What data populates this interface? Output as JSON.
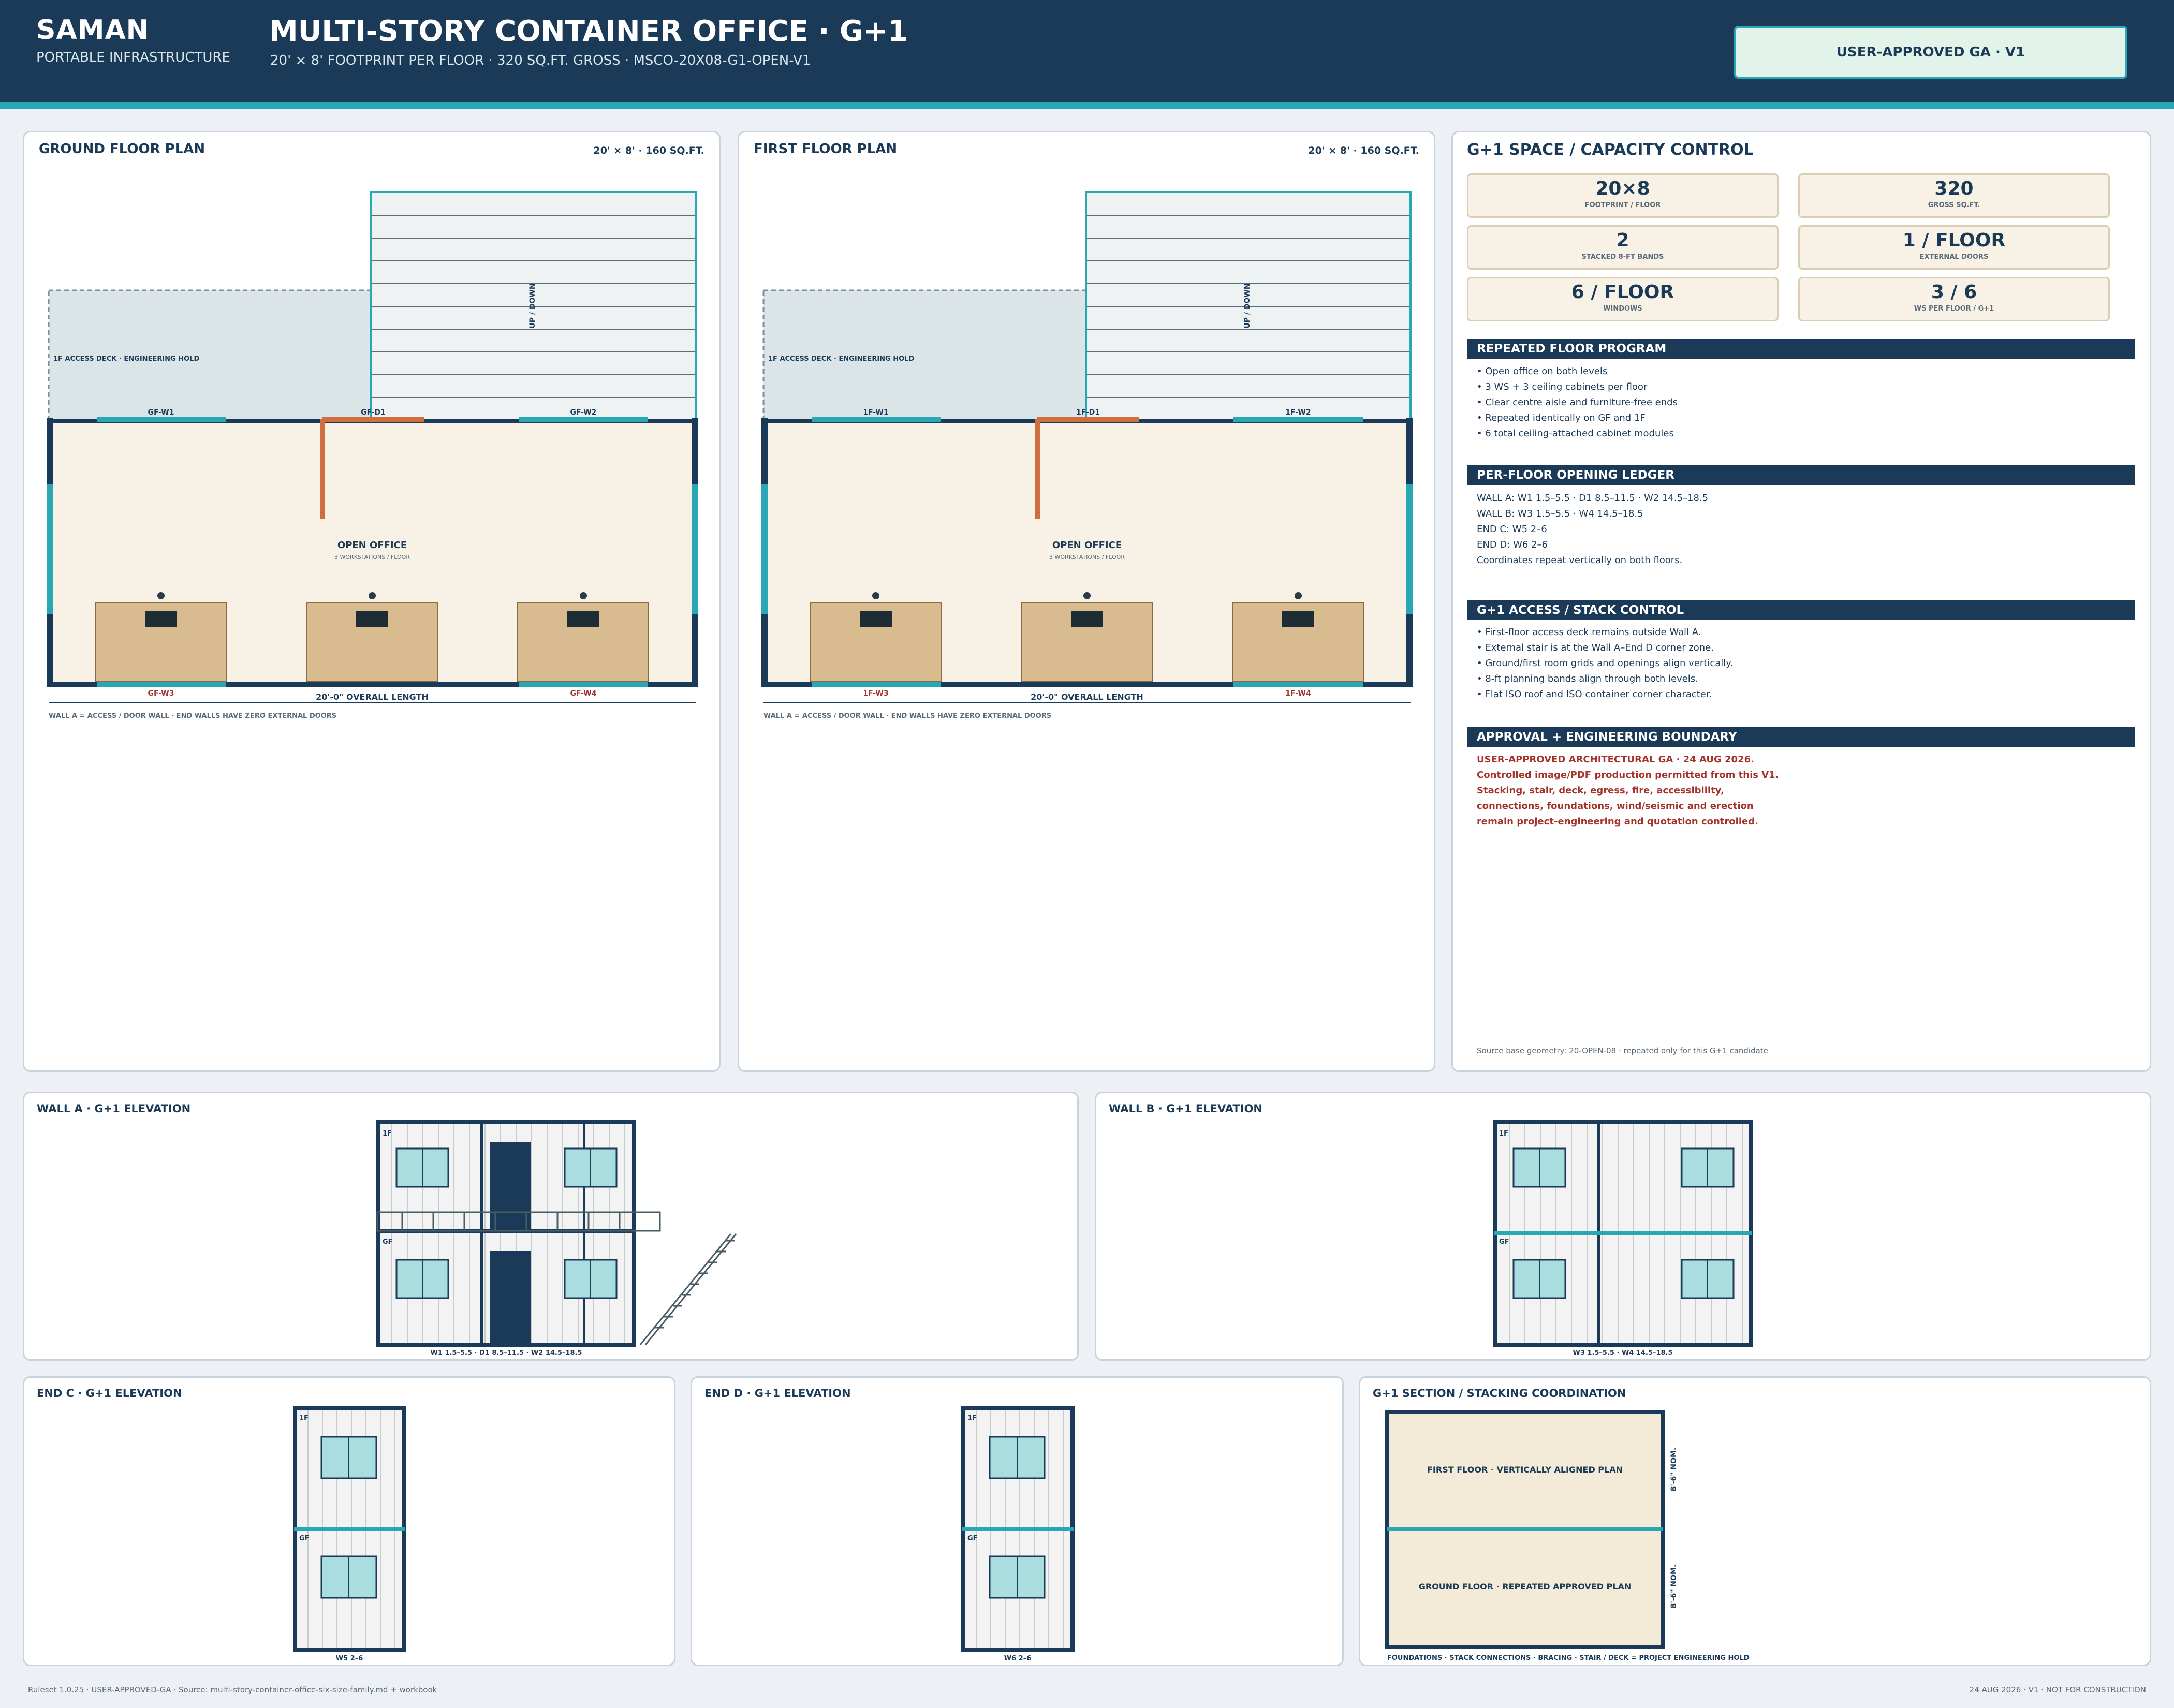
{
  "header": {
    "brand": "SAMAN",
    "brand_sub": "PORTABLE INFRASTRUCTURE",
    "title": "MULTI-STORY CONTAINER OFFICE · G+1",
    "subtitle": "20' × 8' FOOTPRINT PER FLOOR · 320 SQ.FT. GROSS · MSCO-20X08-G1-OPEN-V1",
    "badge": "USER-APPROVED GA · V1"
  },
  "ground_plan": {
    "title": "GROUND FLOOR PLAN",
    "meta": "20' × 8' · 160 SQ.FT.",
    "deck_label": "1F ACCESS DECK · ENGINEERING HOLD",
    "stair_label": "UP / DOWN",
    "room_label": "OPEN OFFICE",
    "room_sub": "3 WORKSTATIONS / FLOOR",
    "w1": "GF-W1",
    "d1": "GF-D1",
    "w2": "GF-W2",
    "w3": "GF-W3",
    "w4": "GF-W4",
    "dimension": "20'-0\" OVERALL LENGTH",
    "note": "WALL A = ACCESS / DOOR WALL · END WALLS HAVE ZERO EXTERNAL DOORS"
  },
  "first_plan": {
    "title": "FIRST FLOOR PLAN",
    "meta": "20' × 8' · 160 SQ.FT.",
    "deck_label": "1F ACCESS DECK · ENGINEERING HOLD",
    "stair_label": "UP / DOWN",
    "room_label": "OPEN OFFICE",
    "room_sub": "3 WORKSTATIONS / FLOOR",
    "w1": "1F-W1",
    "d1": "1F-D1",
    "w2": "1F-W2",
    "w3": "1F-W3",
    "w4": "1F-W4",
    "dimension": "20'-0\" OVERALL LENGTH",
    "note": "WALL A = ACCESS / DOOR WALL · END WALLS HAVE ZERO EXTERNAL DOORS"
  },
  "control": {
    "title": "G+1 SPACE / CAPACITY CONTROL",
    "stats": [
      {
        "value": "20×8",
        "label": "FOOTPRINT / FLOOR"
      },
      {
        "value": "320",
        "label": "GROSS SQ.FT."
      },
      {
        "value": "2",
        "label": "STACKED 8-FT BANDS"
      },
      {
        "value": "1 / FLOOR",
        "label": "EXTERNAL DOORS"
      },
      {
        "value": "6 / FLOOR",
        "label": "WINDOWS"
      },
      {
        "value": "3 / 6",
        "label": "WS PER FLOOR / G+1"
      }
    ],
    "sections": [
      {
        "title": "REPEATED FLOOR PROGRAM",
        "lines": [
          "• Open office on both levels",
          "• 3 WS + 3 ceiling cabinets per floor",
          "• Clear centre aisle and furniture-free ends",
          "• Repeated identically on GF and 1F",
          "• 6 total ceiling-attached cabinet modules"
        ]
      },
      {
        "title": "PER-FLOOR OPENING LEDGER",
        "lines": [
          "WALL A: W1 1.5–5.5 · D1 8.5–11.5 · W2 14.5–18.5",
          "WALL B: W3 1.5–5.5 · W4 14.5–18.5",
          "END C: W5 2–6",
          "END D: W6 2–6",
          "Coordinates repeat vertically on both floors."
        ]
      },
      {
        "title": "G+1 ACCESS / STACK CONTROL",
        "lines": [
          "• First-floor access deck remains outside Wall A.",
          "• External stair is at the Wall A–End D corner zone.",
          "• Ground/first room grids and openings align vertically.",
          "• 8-ft planning bands align through both levels.",
          "• Flat ISO roof and ISO container corner character."
        ]
      },
      {
        "title": "APPROVAL + ENGINEERING BOUNDARY",
        "lines": [
          "USER-APPROVED ARCHITECTURAL GA · 24 AUG 2026.",
          "Controlled image/PDF production permitted from this V1.",
          "Stacking, stair, deck, egress, fire, accessibility,",
          "connections, foundations, wind/seismic and erection",
          "remain project-engineering and quotation controlled."
        ]
      }
    ],
    "source_note": "Source base geometry: 20-OPEN-08 · repeated only for this G+1 candidate"
  },
  "elev_a": {
    "title": "WALL A · G+1 ELEVATION",
    "upper": "1F",
    "lower": "GF",
    "caption": "W1 1.5–5.5 · D1 8.5–11.5 · W2 14.5–18.5"
  },
  "elev_b": {
    "title": "WALL B · G+1 ELEVATION",
    "upper": "1F",
    "lower": "GF",
    "caption": "W3 1.5–5.5 · W4 14.5–18.5"
  },
  "elev_c": {
    "title": "END C · G+1 ELEVATION",
    "upper": "1F",
    "lower": "GF",
    "caption": "W5 2–6"
  },
  "elev_d": {
    "title": "END D · G+1 ELEVATION",
    "upper": "1F",
    "lower": "GF",
    "caption": "W6 2–6"
  },
  "section": {
    "title": "G+1 SECTION / STACKING COORDINATION",
    "upper": "FIRST FLOOR · VERTICALLY ALIGNED PLAN",
    "lower": "GROUND FLOOR · REPEATED APPROVED PLAN",
    "dim_upper": "8'-6\" NOM.",
    "dim_lower": "8'-6\" NOM.",
    "note": "FOUNDATIONS · STACK CONNECTIONS · BRACING · STAIR / DECK = PROJECT ENGINEERING HOLD"
  },
  "footer": {
    "left": "Ruleset 1.0.25 · USER-APPROVED-GA · Source: multi-story-container-office-six-size-family.md + workbook",
    "right": "24 AUG 2026 · V1 · NOT FOR CONSTRUCTION"
  }
}
